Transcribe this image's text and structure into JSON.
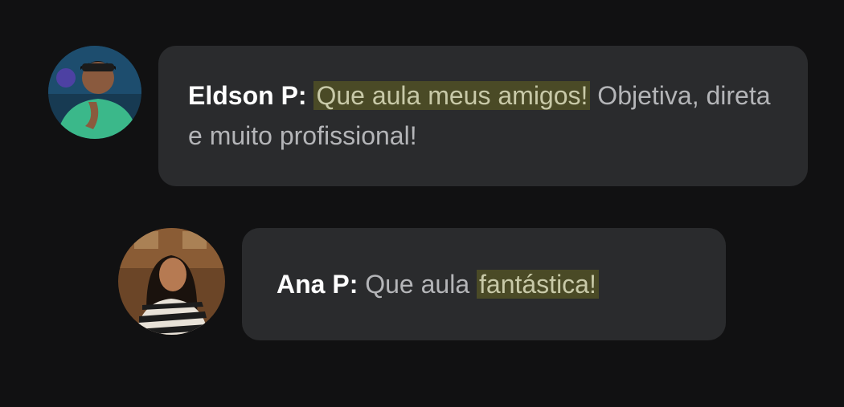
{
  "comments": [
    {
      "author": "Eldson P:",
      "highlight": "Que aula meus amigos!",
      "text_after": " Objetiva, direta e muito profissional!"
    },
    {
      "author": "Ana P:",
      "text_before": "Que aula ",
      "highlight": "fantástica!"
    }
  ],
  "colors": {
    "background": "#111112",
    "bubble": "#2a2b2d",
    "author_text": "#ffffff",
    "body_text": "#b4b5b8",
    "highlight_bg": "#4a4a26"
  }
}
